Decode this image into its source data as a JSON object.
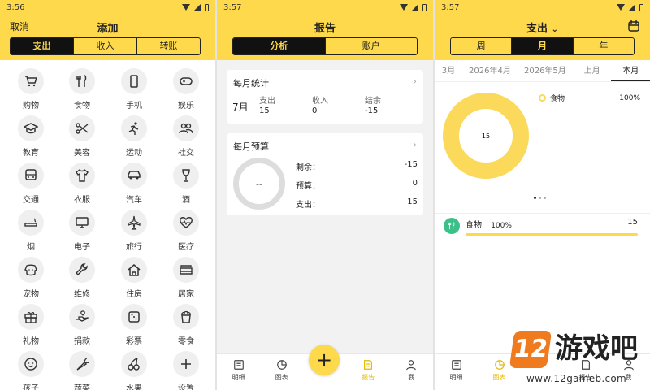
{
  "p1": {
    "time": "3:56",
    "cancel": "取消",
    "title": "添加",
    "tabs": [
      "支出",
      "收入",
      "转账"
    ],
    "cats": [
      {
        "label": "购物",
        "icon": "cart-icon"
      },
      {
        "label": "食物",
        "icon": "fork-knife-icon"
      },
      {
        "label": "手机",
        "icon": "phone-icon"
      },
      {
        "label": "娱乐",
        "icon": "gamepad-icon"
      },
      {
        "label": "教育",
        "icon": "graduation-cap-icon"
      },
      {
        "label": "美容",
        "icon": "scissors-icon"
      },
      {
        "label": "运动",
        "icon": "running-icon"
      },
      {
        "label": "社交",
        "icon": "people-icon"
      },
      {
        "label": "交通",
        "icon": "bus-icon"
      },
      {
        "label": "衣服",
        "icon": "shirt-icon"
      },
      {
        "label": "汽车",
        "icon": "car-icon"
      },
      {
        "label": "酒",
        "icon": "wine-glass-icon"
      },
      {
        "label": "烟",
        "icon": "cigarette-icon"
      },
      {
        "label": "电子",
        "icon": "monitor-icon"
      },
      {
        "label": "旅行",
        "icon": "airplane-icon"
      },
      {
        "label": "医疗",
        "icon": "heartbeat-icon"
      },
      {
        "label": "宠物",
        "icon": "dog-icon"
      },
      {
        "label": "维修",
        "icon": "wrench-icon"
      },
      {
        "label": "住房",
        "icon": "house-icon"
      },
      {
        "label": "居家",
        "icon": "sofa-icon"
      },
      {
        "label": "礼物",
        "icon": "gift-icon"
      },
      {
        "label": "捐款",
        "icon": "donate-icon"
      },
      {
        "label": "彩票",
        "icon": "dice-icon"
      },
      {
        "label": "零食",
        "icon": "popcorn-icon"
      },
      {
        "label": "孩子",
        "icon": "baby-icon"
      },
      {
        "label": "蔬菜",
        "icon": "carrot-icon"
      },
      {
        "label": "水果",
        "icon": "cherry-icon"
      },
      {
        "label": "设置",
        "icon": "plus-icon"
      }
    ]
  },
  "p2": {
    "time": "3:57",
    "title": "报告",
    "tabs": [
      "分析",
      "账户"
    ],
    "monthly": {
      "title": "每月统计",
      "month": "7月",
      "cols": [
        "支出",
        "收入",
        "结余"
      ],
      "vals": [
        "15",
        "0",
        "-15"
      ]
    },
    "budget": {
      "title": "每月预算",
      "ring": "--",
      "rows": [
        {
          "k": "剩余：",
          "v": "-15"
        },
        {
          "k": "预算：",
          "v": "0"
        },
        {
          "k": "支出：",
          "v": "15"
        }
      ]
    },
    "nav": [
      {
        "label": "明细",
        "icon": "list-icon"
      },
      {
        "label": "图表",
        "icon": "pie-chart-icon"
      },
      {
        "label": "",
        "icon": "plus-icon"
      },
      {
        "label": "报告",
        "icon": "report-icon"
      },
      {
        "label": "我",
        "icon": "user-icon"
      }
    ],
    "fab": "+"
  },
  "p3": {
    "time": "3:57",
    "title": "支出",
    "period_tabs": [
      "周",
      "月",
      "年"
    ],
    "month_tabs": [
      "3月",
      "2026年4月",
      "2026年5月",
      "上月",
      "本月"
    ],
    "legend_label": "食物",
    "legend_pct": "100%",
    "center_value": "15",
    "row": {
      "label": "食物",
      "pct": "100%",
      "amount": "15"
    },
    "nav": [
      {
        "label": "明细"
      },
      {
        "label": "图表"
      },
      {
        "label": ""
      },
      {
        "label": "报告"
      },
      {
        "label": "我"
      }
    ]
  },
  "chart_data": {
    "type": "pie",
    "categories": [
      "食物"
    ],
    "values": [
      15
    ],
    "title": ""
  },
  "watermark": {
    "brand": "12",
    "text": "游戏吧",
    "url": "www.12gameb.com"
  },
  "colors": {
    "accent": "#fed94b",
    "dark": "#111111",
    "ring": "#fbd95a",
    "green": "#3cc08a"
  }
}
